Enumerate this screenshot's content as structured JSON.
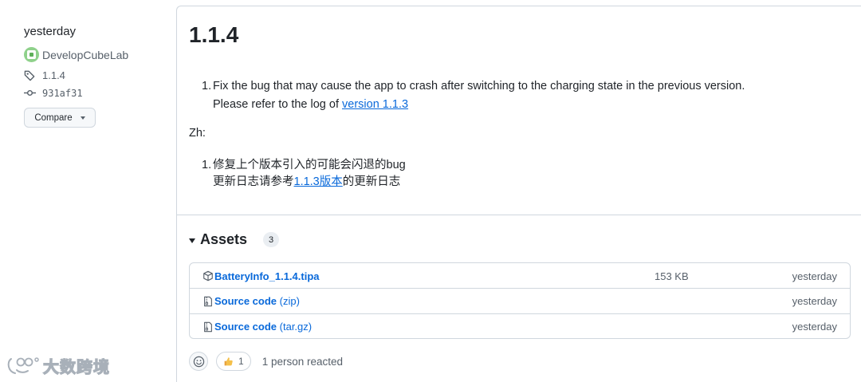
{
  "sidebar": {
    "relative_time": "yesterday",
    "author": "DevelopCubeLab",
    "tag": "1.1.4",
    "commit": "931af31",
    "compare_label": "Compare"
  },
  "release": {
    "title": "1.1.4",
    "notes": {
      "en_item_num": "1.",
      "en_line1": "Fix the bug that may cause the app to crash after switching to the charging state in the previous version.",
      "en_line2_prefix": "Please refer to the log of ",
      "en_line2_link": "version 1.1.3",
      "zh_label": "Zh:",
      "zh_item_num": "1.",
      "zh_line1": "修复上个版本引入的可能会闪退的bug",
      "zh_line2_prefix": "更新日志请参考",
      "zh_line2_link": "1.1.3版本",
      "zh_line2_suffix": "的更新日志"
    }
  },
  "assets": {
    "title": "Assets",
    "count": "3",
    "items": [
      {
        "name": "BatteryInfo_1.1.4.tipa",
        "ext": "",
        "size": "153 KB",
        "time": "yesterday",
        "icon": "package-icon"
      },
      {
        "name": "Source code",
        "ext": " (zip)",
        "size": "",
        "time": "yesterday",
        "icon": "file-zip-icon"
      },
      {
        "name": "Source code",
        "ext": " (tar.gz)",
        "size": "",
        "time": "yesterday",
        "icon": "file-zip-icon"
      }
    ]
  },
  "reactions": {
    "thumbs_count": "1",
    "summary": "1 person reacted"
  },
  "watermark": {
    "text": "大数跨境"
  },
  "colors": {
    "link": "#0969da",
    "border": "#d0d7de",
    "muted": "#57606a",
    "text": "#1f2328"
  }
}
